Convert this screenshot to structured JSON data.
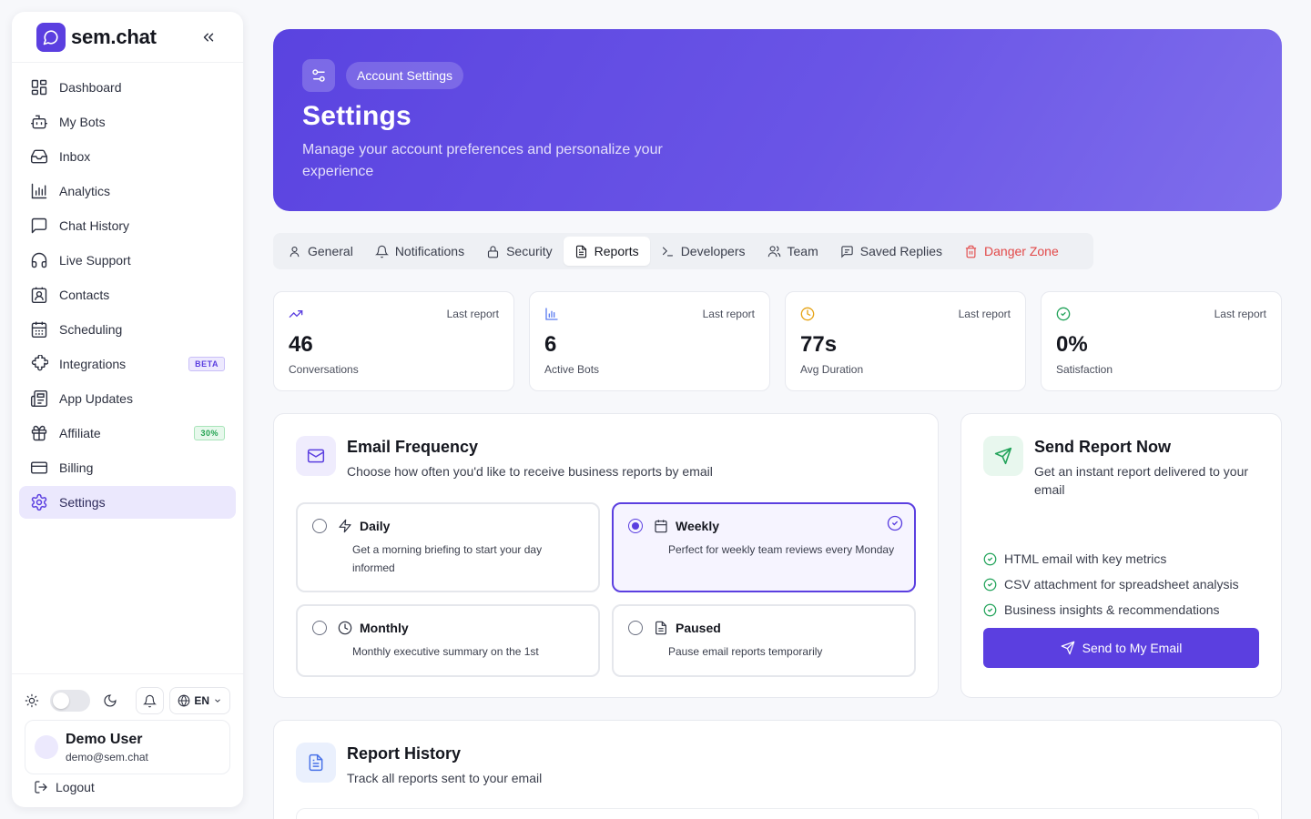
{
  "brand": {
    "name": "sem.chat",
    "accent": "#5b3fe0"
  },
  "sidebar": {
    "items": [
      {
        "label": "Dashboard",
        "icon": "dashboard-icon"
      },
      {
        "label": "My Bots",
        "icon": "bot-icon"
      },
      {
        "label": "Inbox",
        "icon": "inbox-icon"
      },
      {
        "label": "Analytics",
        "icon": "bar-chart-icon"
      },
      {
        "label": "Chat History",
        "icon": "chat-icon"
      },
      {
        "label": "Live Support",
        "icon": "headphones-icon"
      },
      {
        "label": "Contacts",
        "icon": "contact-icon"
      },
      {
        "label": "Scheduling",
        "icon": "calendar-icon"
      },
      {
        "label": "Integrations",
        "icon": "puzzle-icon",
        "badge": "BETA"
      },
      {
        "label": "App Updates",
        "icon": "newspaper-icon"
      },
      {
        "label": "Affiliate",
        "icon": "gift-icon",
        "badge": "30%"
      },
      {
        "label": "Billing",
        "icon": "credit-card-icon"
      },
      {
        "label": "Settings",
        "icon": "gear-icon",
        "active": true
      }
    ],
    "language": "EN",
    "user": {
      "name": "Demo User",
      "email": "demo@sem.chat"
    },
    "logout_label": "Logout"
  },
  "hero": {
    "pill": "Account Settings",
    "title": "Settings",
    "subtitle": "Manage your account preferences and personalize your experience"
  },
  "tabs": [
    {
      "label": "General",
      "icon": "user-icon"
    },
    {
      "label": "Notifications",
      "icon": "bell-icon"
    },
    {
      "label": "Security",
      "icon": "lock-icon"
    },
    {
      "label": "Reports",
      "icon": "file-icon",
      "active": true
    },
    {
      "label": "Developers",
      "icon": "terminal-icon"
    },
    {
      "label": "Team",
      "icon": "users-icon"
    },
    {
      "label": "Saved Replies",
      "icon": "message-icon"
    },
    {
      "label": "Danger Zone",
      "icon": "trash-icon",
      "danger": true
    }
  ],
  "stats": [
    {
      "meta": "Last report",
      "value": "46",
      "label": "Conversations",
      "icon": "trending-up-icon",
      "color": "#5b3fe0"
    },
    {
      "meta": "Last report",
      "value": "6",
      "label": "Active Bots",
      "icon": "bar-chart-icon",
      "color": "#5b7cf0"
    },
    {
      "meta": "Last report",
      "value": "77s",
      "label": "Avg Duration",
      "icon": "clock-icon",
      "color": "#e6a316"
    },
    {
      "meta": "Last report",
      "value": "0%",
      "label": "Satisfaction",
      "icon": "check-circle-icon",
      "color": "#22a35a"
    }
  ],
  "frequency": {
    "title": "Email Frequency",
    "subtitle": "Choose how often you'd like to receive business reports by email",
    "options": [
      {
        "name": "Daily",
        "desc": "Get a morning briefing to start your day informed",
        "icon": "zap-icon"
      },
      {
        "name": "Weekly",
        "desc": "Perfect for weekly team reviews every Monday",
        "icon": "calendar-icon",
        "selected": true
      },
      {
        "name": "Monthly",
        "desc": "Monthly executive summary on the 1st",
        "icon": "clock-icon"
      },
      {
        "name": "Paused",
        "desc": "Pause email reports temporarily",
        "icon": "file-icon"
      }
    ]
  },
  "send_report": {
    "title": "Send Report Now",
    "subtitle": "Get an instant report delivered to your email",
    "features": [
      "HTML email with key metrics",
      "CSV attachment for spreadsheet analysis",
      "Business insights & recommendations"
    ],
    "button_label": "Send to My Email"
  },
  "history": {
    "title": "Report History",
    "subtitle": "Track all reports sent to your email"
  }
}
